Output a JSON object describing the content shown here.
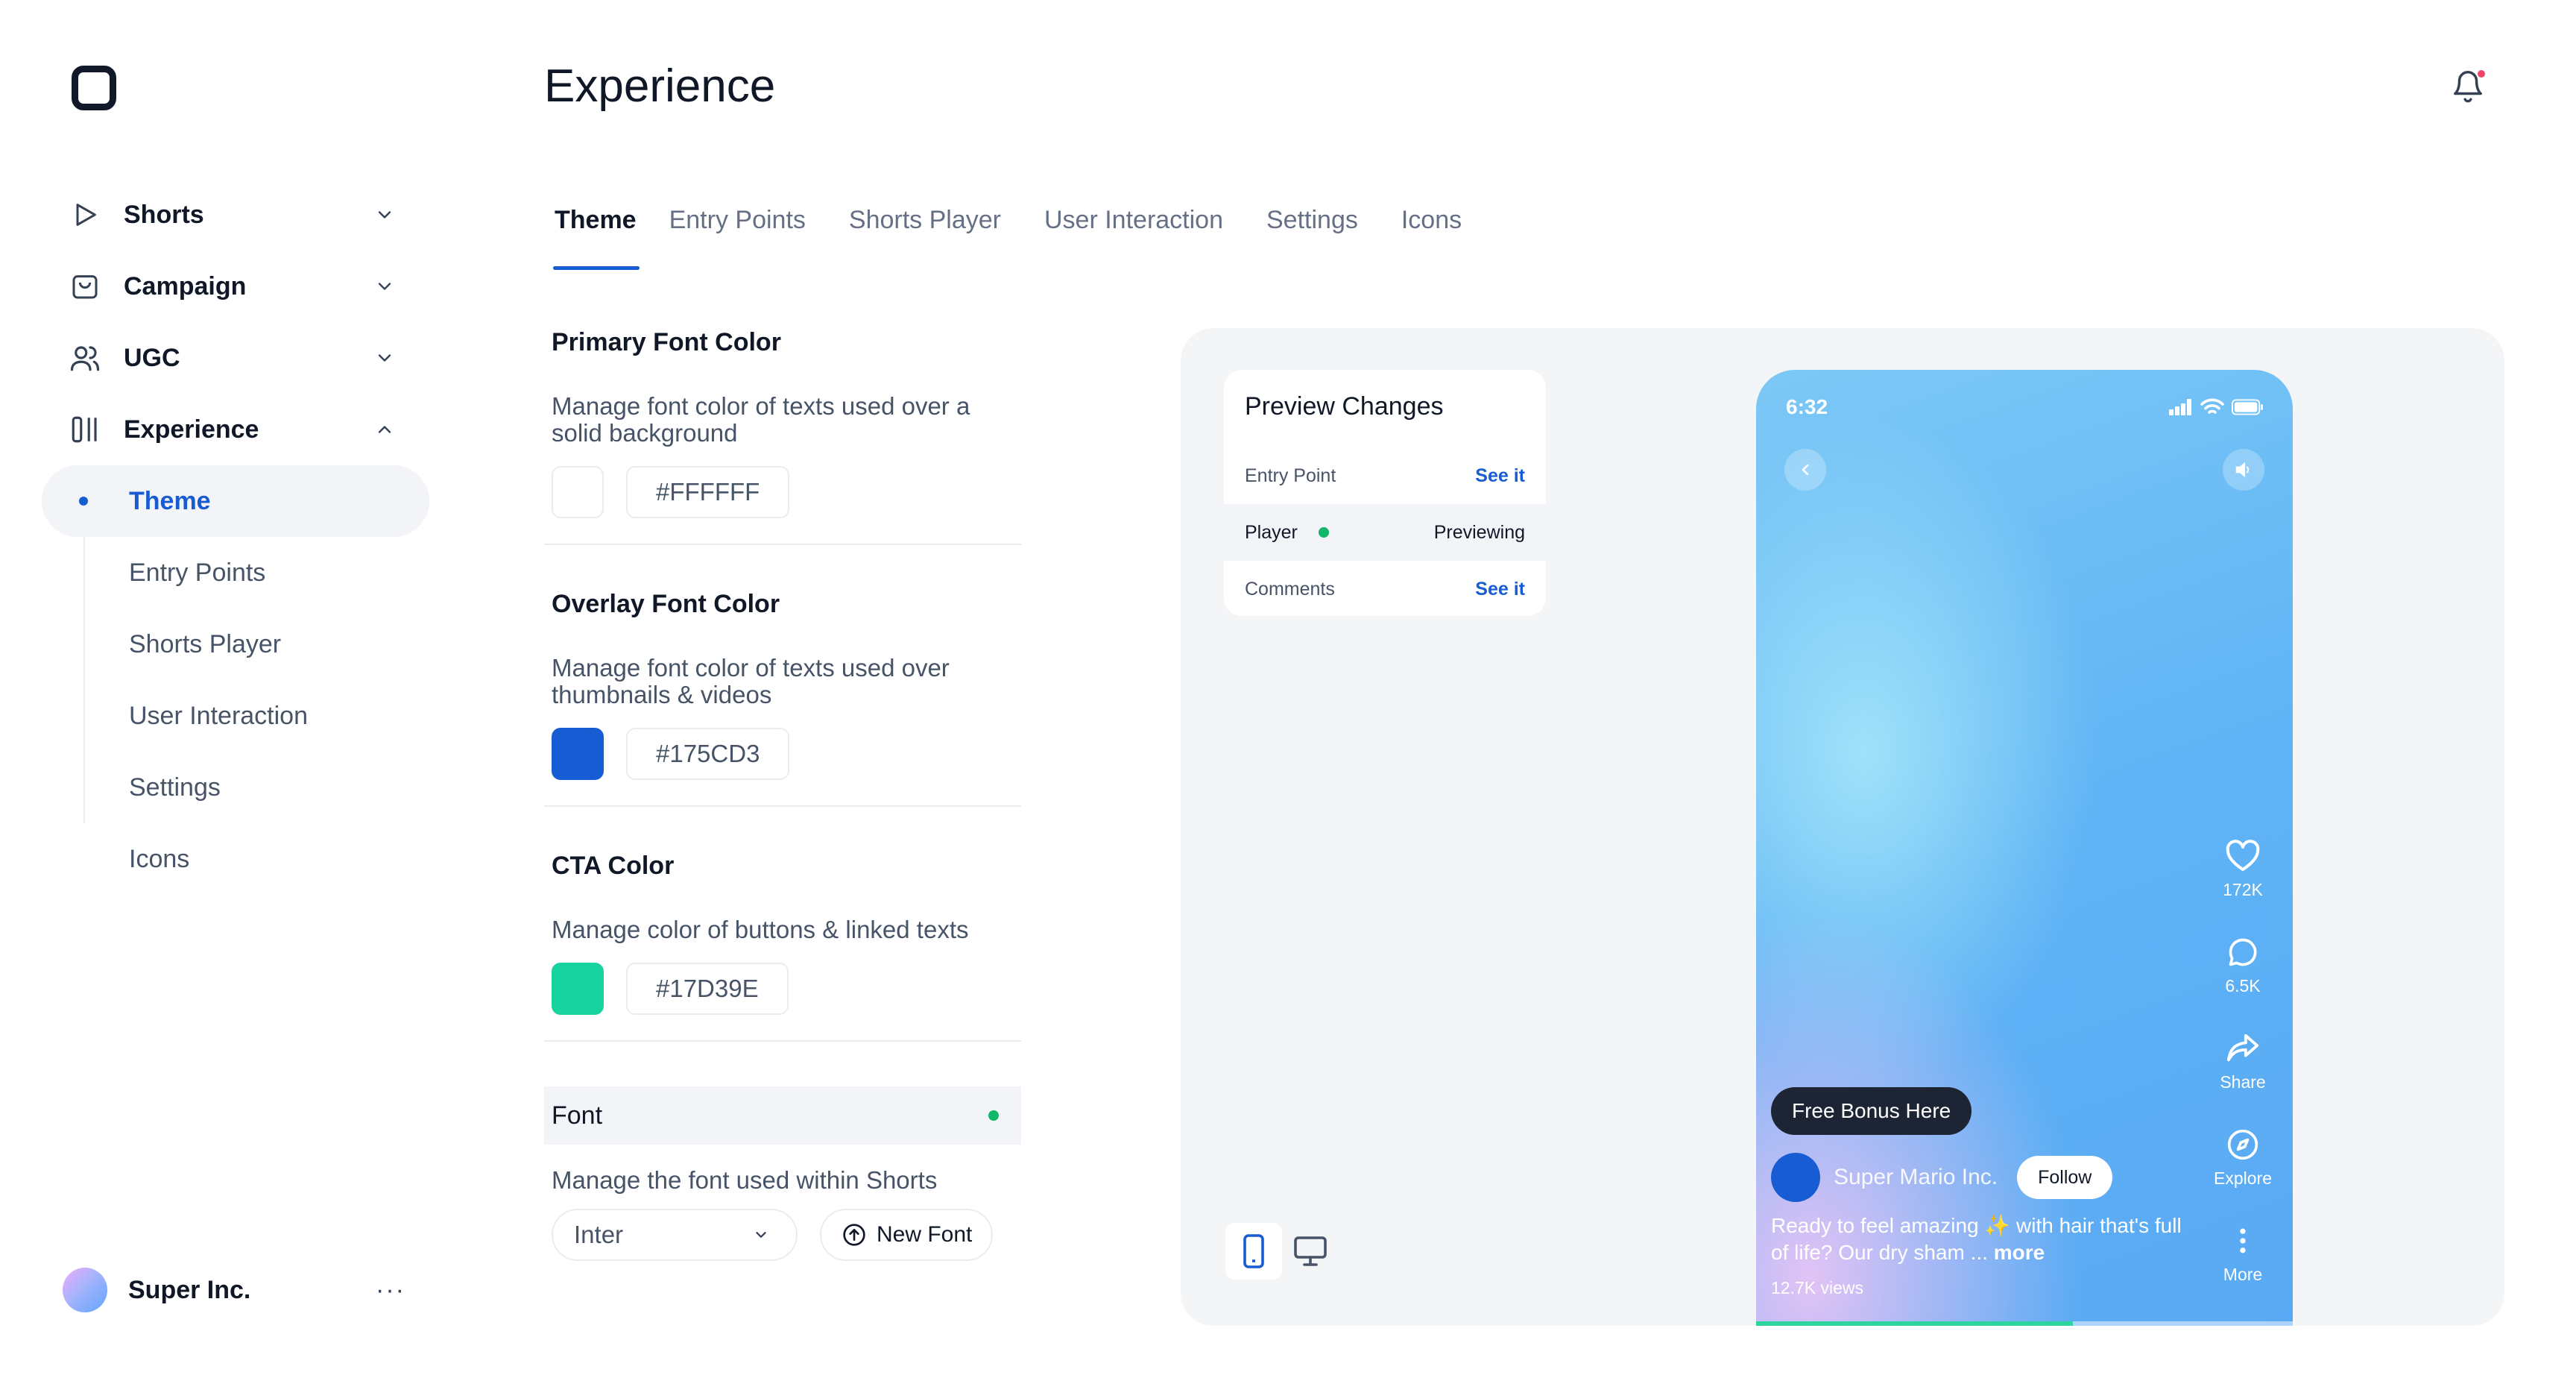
{
  "sidebar": {
    "items": [
      {
        "label": "Shorts",
        "icon": "play-icon"
      },
      {
        "label": "Campaign",
        "icon": "bag-icon"
      },
      {
        "label": "UGC",
        "icon": "users-icon"
      },
      {
        "label": "Experience",
        "icon": "columns-icon"
      }
    ],
    "subitems": [
      "Theme",
      "Entry Points",
      "Shorts Player",
      "User Interaction",
      "Settings",
      "Icons"
    ],
    "account": {
      "name": "Super Inc.",
      "more": "···"
    }
  },
  "header": {
    "title": "Experience"
  },
  "tabs": [
    "Theme",
    "Entry Points",
    "Shorts Player",
    "User Interaction",
    "Settings",
    "Icons"
  ],
  "settings": {
    "primary": {
      "title": "Primary Font Color",
      "desc": "Manage font color of texts used over a solid background",
      "hex": "#FFFFFF",
      "color": "#FFFFFF"
    },
    "overlay": {
      "title": "Overlay Font Color",
      "desc": "Manage font color of texts used over thumbnails & videos",
      "hex": "#175CD3",
      "color": "#175CD3"
    },
    "cta": {
      "title": "CTA Color",
      "desc": "Manage color of buttons & linked texts",
      "hex": "#17D39E",
      "color": "#17D39E"
    },
    "font": {
      "title": "Font",
      "desc": "Manage the font used within Shorts",
      "value": "Inter",
      "new_label": "New Font"
    }
  },
  "preview": {
    "title": "Preview Changes",
    "rows": {
      "entry": {
        "label": "Entry Point",
        "action": "See it"
      },
      "player": {
        "label": "Player",
        "status": "Previewing"
      },
      "comments": {
        "label": "Comments",
        "action": "See it"
      }
    },
    "phone": {
      "time": "6:32",
      "likes": "172K",
      "comments": "6.5K",
      "share": "Share",
      "explore": "Explore",
      "more": "More",
      "cta": "Free Bonus Here",
      "creator": "Super Mario Inc.",
      "follow": "Follow",
      "caption": "Ready to feel amazing ✨ with hair that's full of life? Our dry sham ...",
      "caption_more": "more",
      "views": "12.7K views",
      "progress": 0.59
    }
  }
}
